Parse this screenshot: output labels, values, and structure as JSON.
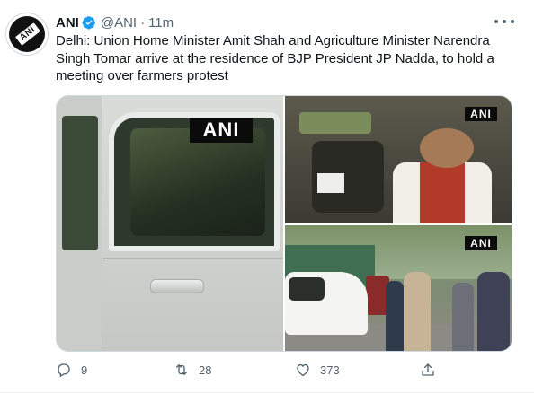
{
  "tweet": {
    "author_name": "ANI",
    "handle": "@ANI",
    "separator": "·",
    "time": "11m",
    "text": "Delhi: Union Home Minister Amit Shah and Agriculture Minister Narendra Singh Tomar arrive at the residence of BJP President JP Nadda, to hold a meeting over farmers protest",
    "avatar_label": "ANI",
    "media": {
      "watermarks": [
        "ANI",
        "ANI",
        "ANI"
      ]
    },
    "actions": {
      "reply_count": "9",
      "retweet_count": "28",
      "like_count": "373"
    }
  },
  "icons": {
    "verified": "verified-badge-icon",
    "more": "more-options-icon",
    "reply": "reply-icon",
    "retweet": "retweet-icon",
    "like": "heart-icon",
    "share": "share-icon"
  },
  "colors": {
    "verified_blue": "#1d9bf0",
    "secondary_text": "#536471",
    "primary_text": "#0f1419"
  }
}
